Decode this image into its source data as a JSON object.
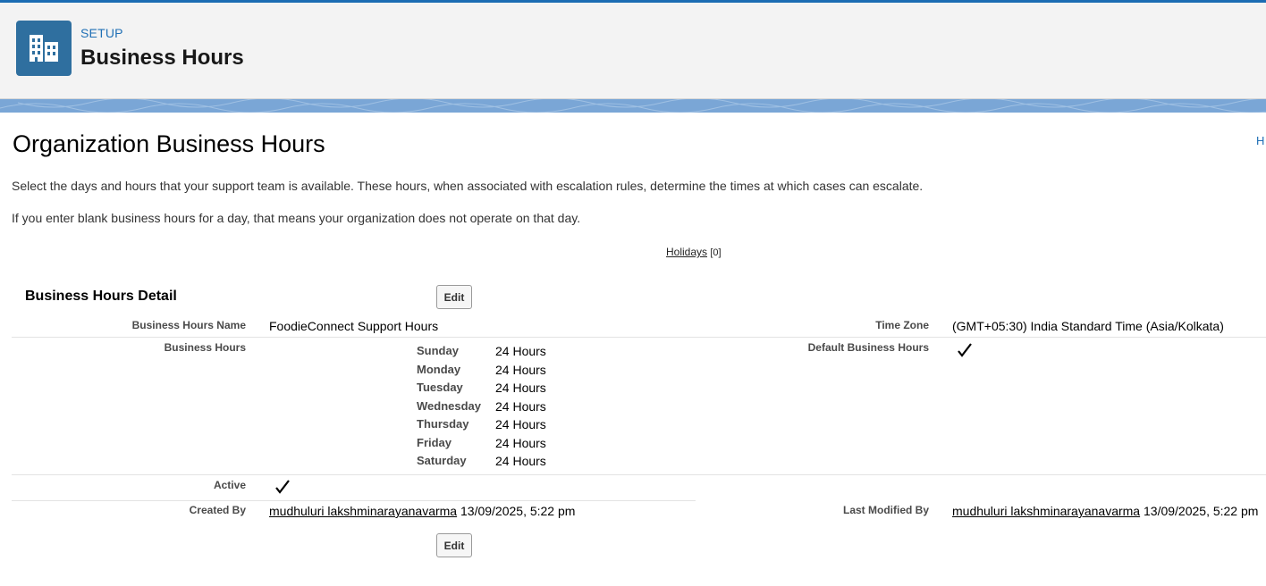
{
  "header": {
    "setup_label": "SETUP",
    "title": "Business Hours",
    "icon": "building-icon"
  },
  "page": {
    "title": "Organization Business Hours",
    "help_link": "H",
    "intro_line1": "Select the days and hours that your support team is available. These hours, when associated with escalation rules, determine the times at which cases can escalate.",
    "intro_line2": "If you enter blank business hours for a day, that means your organization does not operate on that day.",
    "holidays_link": "Holidays",
    "holidays_count": "[0]"
  },
  "detail": {
    "section_title": "Business Hours Detail",
    "edit_label": "Edit",
    "name_label": "Business Hours Name",
    "name_value": "FoodieConnect Support Hours",
    "timezone_label": "Time Zone",
    "timezone_value": "(GMT+05:30) India Standard Time (Asia/Kolkata)",
    "hours_label": "Business Hours",
    "default_label": "Default Business Hours",
    "default_checked": true,
    "days": [
      {
        "day": "Sunday",
        "hours": "24 Hours"
      },
      {
        "day": "Monday",
        "hours": "24 Hours"
      },
      {
        "day": "Tuesday",
        "hours": "24 Hours"
      },
      {
        "day": "Wednesday",
        "hours": "24 Hours"
      },
      {
        "day": "Thursday",
        "hours": "24 Hours"
      },
      {
        "day": "Friday",
        "hours": "24 Hours"
      },
      {
        "day": "Saturday",
        "hours": "24 Hours"
      }
    ],
    "active_label": "Active",
    "active_checked": true,
    "created_label": "Created By",
    "created_user": "mudhuluri lakshminarayanavarma",
    "created_date": "13/09/2025, 5:22 pm",
    "modified_label": "Last Modified By",
    "modified_user": "mudhuluri lakshminarayanavarma",
    "modified_date": "13/09/2025, 5:22 pm"
  },
  "colors": {
    "accent": "#1f6fb5",
    "header_icon_bg": "#2f6f9f",
    "band": "#7aa6d6"
  }
}
